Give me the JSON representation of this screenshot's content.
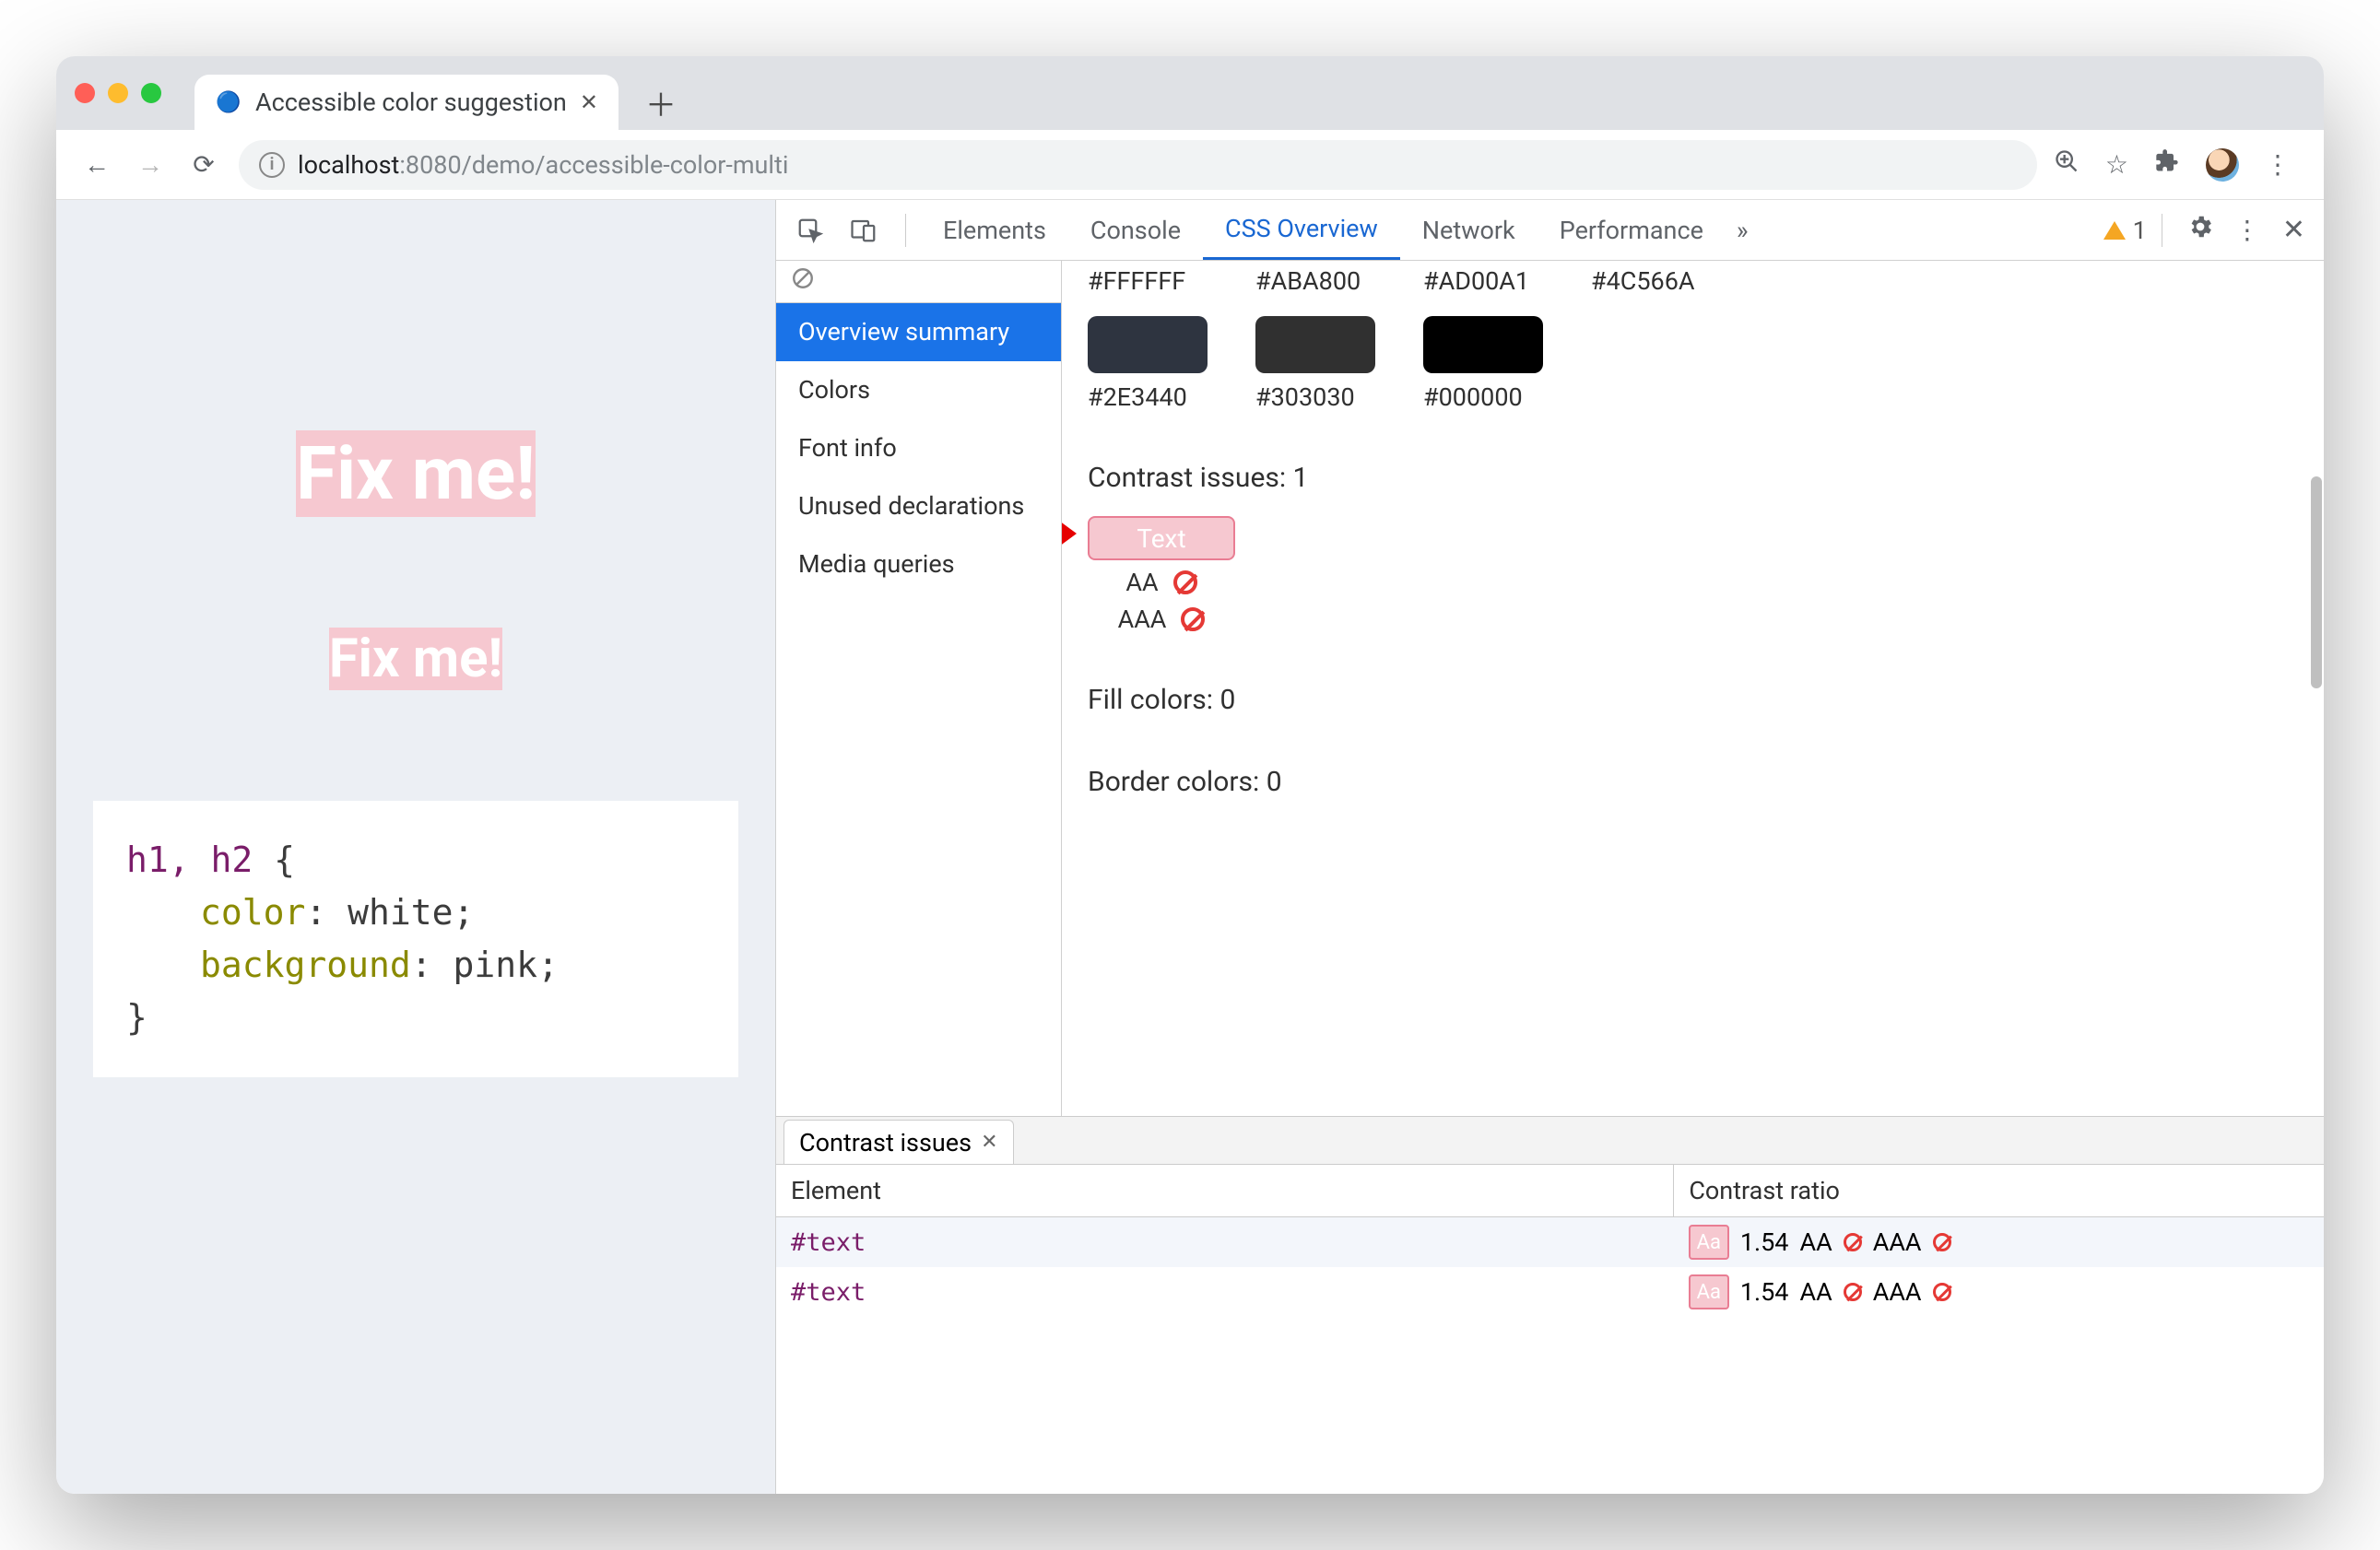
{
  "browser": {
    "tab_title": "Accessible color suggestion",
    "url_host": "localhost",
    "url_port": ":8080",
    "url_path": "/demo/accessible-color-multi"
  },
  "page": {
    "heading1": "Fix me!",
    "heading2": "Fix me!",
    "selector": "h1, h2",
    "prop1": "color",
    "val1": "white",
    "prop2": "background",
    "val2": "pink"
  },
  "devtools": {
    "tabs": [
      "Elements",
      "Console",
      "CSS Overview",
      "Network",
      "Performance"
    ],
    "active_tab": "CSS Overview",
    "warnings": "1",
    "sidebar": {
      "items": [
        "Overview summary",
        "Colors",
        "Font info",
        "Unused declarations",
        "Media queries"
      ],
      "selected_index": 0
    },
    "colors_top": [
      "#FFFFFF",
      "#ABA800",
      "#AD00A1",
      "#4C566A"
    ],
    "colors_mid": [
      {
        "hex": "#2E3440"
      },
      {
        "hex": "#303030"
      },
      {
        "hex": "#000000"
      }
    ],
    "contrast_heading": "Contrast issues: 1",
    "contrast_badge": "Text",
    "aa_label": "AA",
    "aaa_label": "AAA",
    "fill_heading": "Fill colors: 0",
    "border_heading": "Border colors: 0",
    "drawer": {
      "tab_title": "Contrast issues",
      "col1": "Element",
      "col2": "Contrast ratio",
      "rows": [
        {
          "element": "#text",
          "ratio": "1.54",
          "aa": "AA",
          "aaa": "AAA"
        },
        {
          "element": "#text",
          "ratio": "1.54",
          "aa": "AA",
          "aaa": "AAA"
        }
      ]
    }
  }
}
